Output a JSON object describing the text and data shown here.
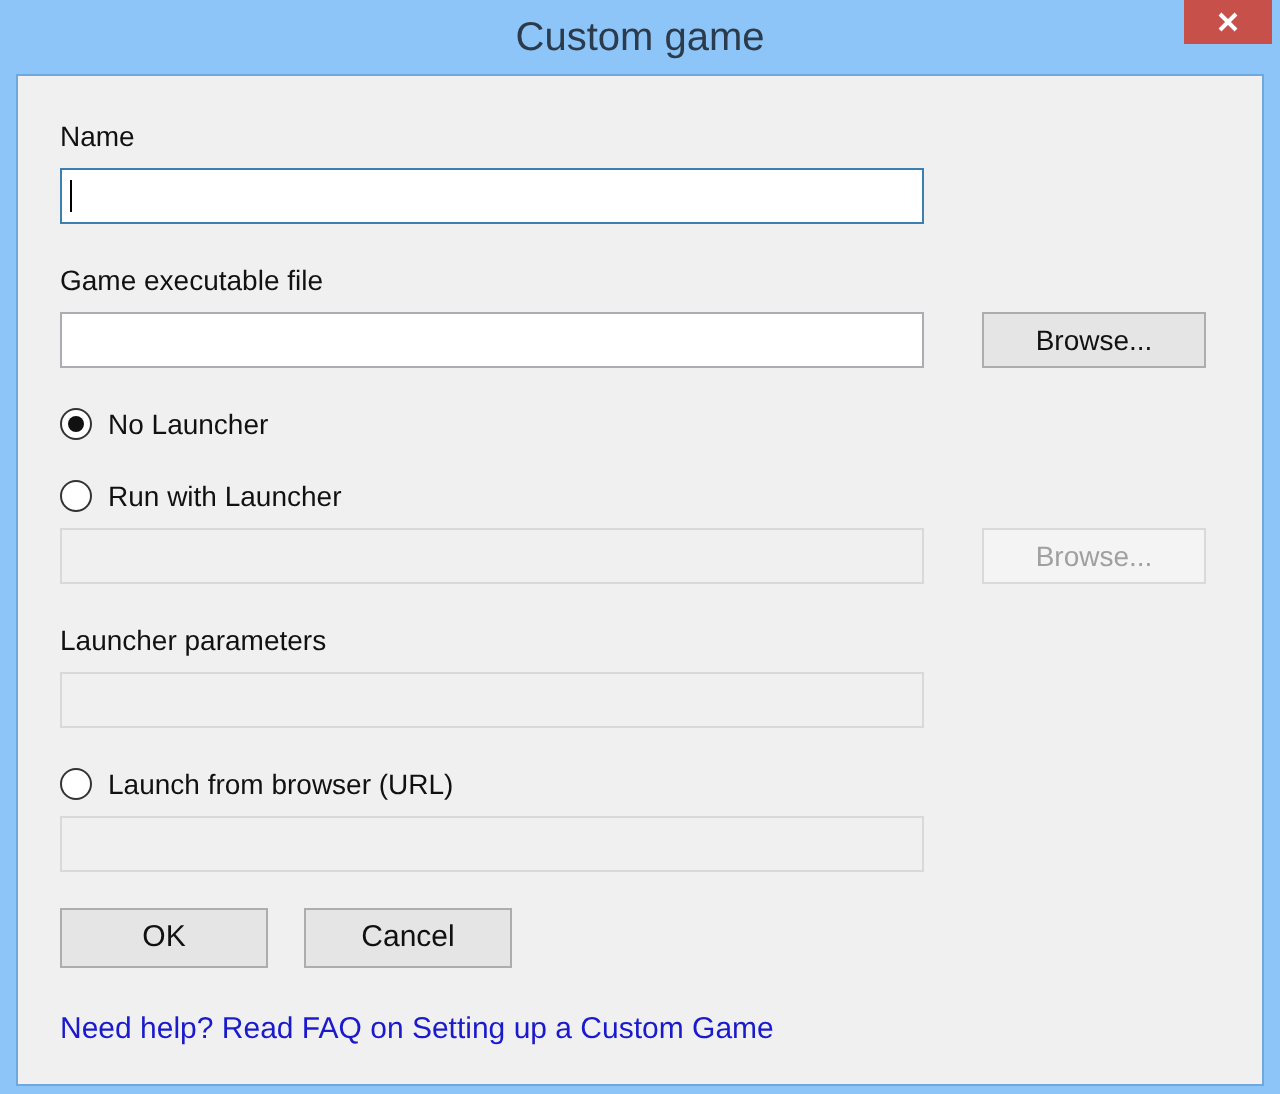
{
  "window": {
    "title": "Custom game"
  },
  "items": [
    {
      "kind": "label",
      "text": "Name"
    },
    {
      "kind": "field",
      "focused": true,
      "disabled": false
    },
    {
      "kind": "label",
      "text": "Game executable file"
    },
    {
      "kind": "field",
      "focused": false,
      "disabled": false,
      "button": {
        "label": "Browse...",
        "disabled": false
      }
    },
    {
      "kind": "radio",
      "label": "No Launcher",
      "selected": true
    },
    {
      "kind": "radio",
      "label": "Run with Launcher",
      "selected": false
    },
    {
      "kind": "field",
      "focused": false,
      "disabled": true,
      "button": {
        "label": "Browse...",
        "disabled": true
      }
    },
    {
      "kind": "label",
      "text": "Launcher parameters"
    },
    {
      "kind": "field",
      "focused": false,
      "disabled": true
    },
    {
      "kind": "radio",
      "label": "Launch from browser (URL)",
      "selected": false
    },
    {
      "kind": "field",
      "focused": false,
      "disabled": true
    }
  ],
  "buttons": [
    {
      "label": "OK"
    },
    {
      "label": "Cancel"
    }
  ],
  "help_link": "Need help? Read FAQ on Setting up a Custom Game"
}
